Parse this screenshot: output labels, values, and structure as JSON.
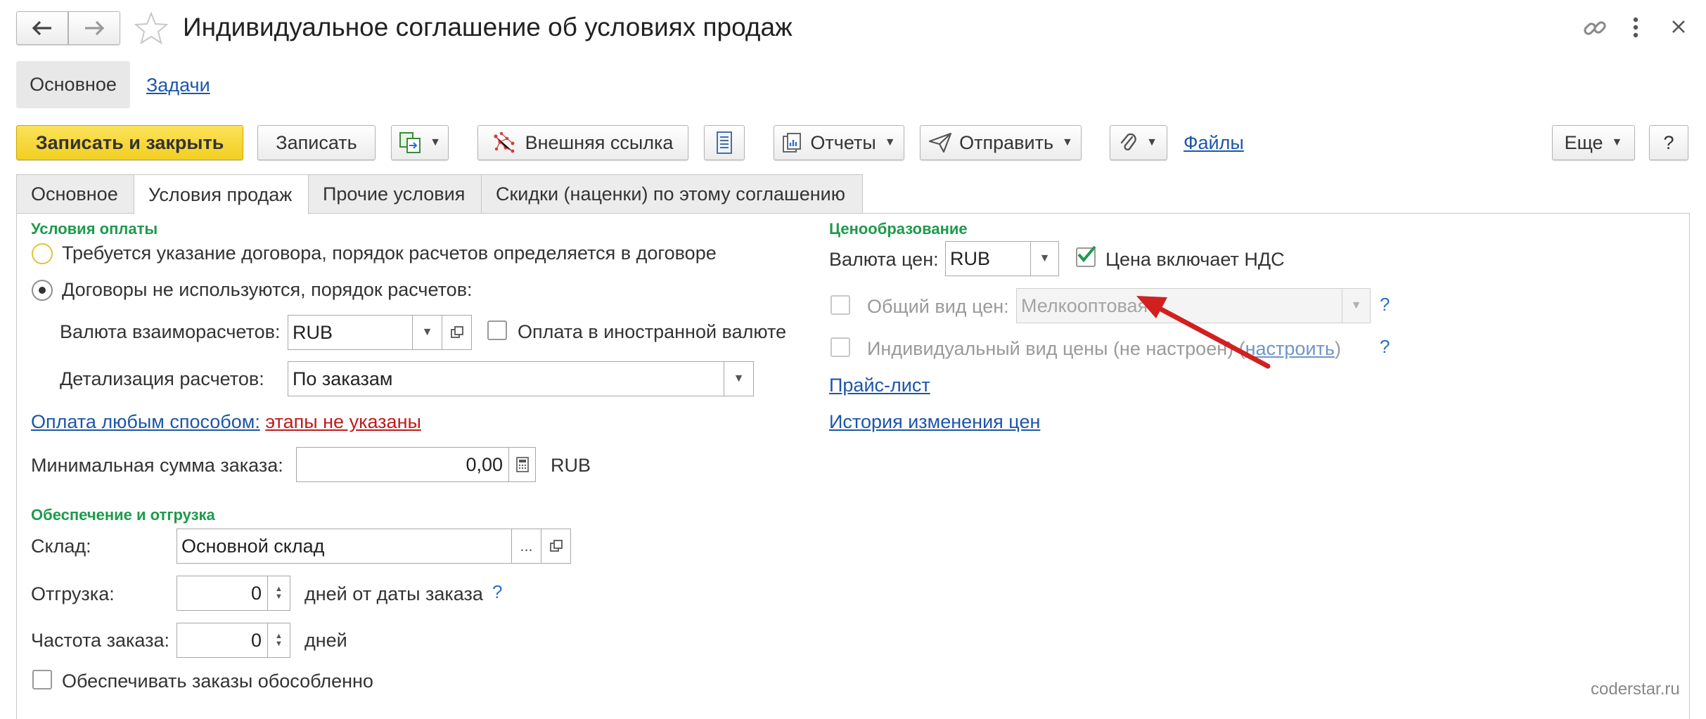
{
  "window": {
    "title": "Индивидуальное соглашение об условиях продаж",
    "nav_tabs": [
      "Основное",
      "Задачи"
    ]
  },
  "toolbar": {
    "save_close": "Записать и закрыть",
    "save": "Записать",
    "external_link": "Внешняя ссылка",
    "reports": "Отчеты",
    "send": "Отправить",
    "files": "Файлы",
    "more": "Еще",
    "help": "?"
  },
  "tabs": [
    "Основное",
    "Условия продаж",
    "Прочие условия",
    "Скидки (наценки) по этому соглашению"
  ],
  "payment": {
    "section": "Условия оплаты",
    "option1": "Требуется указание договора, порядок расчетов определяется в договоре",
    "option2": "Договоры не используются, порядок расчетов:",
    "currency_label": "Валюта взаиморасчетов:",
    "currency_value": "RUB",
    "foreign_label": "Оплата в иностранной валюте",
    "detail_label": "Детализация расчетов:",
    "detail_value": "По заказам",
    "any_method_link": "Оплата любым способом:",
    "stages_link": "этапы не указаны",
    "min_sum_label": "Минимальная сумма заказа:",
    "min_sum_value": "0,00",
    "min_sum_currency": "RUB"
  },
  "shipping": {
    "section": "Обеспечение и отгрузка",
    "warehouse_label": "Склад:",
    "warehouse_value": "Основной склад",
    "warehouse_dots": "...",
    "ship_label": "Отгрузка:",
    "ship_value": "0",
    "ship_unit": "дней от даты заказа",
    "freq_label": "Частота заказа:",
    "freq_value": "0",
    "freq_unit": "дней",
    "separate_label": "Обеспечивать заказы обособленно"
  },
  "pricing": {
    "section": "Ценообразование",
    "currency_label": "Валюта цен:",
    "currency_value": "RUB",
    "vat_label": "Цена включает НДС",
    "common_label": "Общий вид цен:",
    "common_value": "Мелкооптовая",
    "individual_label": "Индивидуальный вид цены (не настроен) (",
    "configure_link": "настроить",
    "individual_close": ")",
    "price_list_link": "Прайс-лист",
    "history_link": "История изменения цен",
    "help": "?"
  },
  "watermark": "coderstar.ru",
  "colors": {
    "accent_yellow": "#f5d63a",
    "section_green": "#1f9a4c",
    "link_blue": "#1d56a8",
    "warning_red": "#c21a1a",
    "arrow_red": "#d21f1f"
  }
}
